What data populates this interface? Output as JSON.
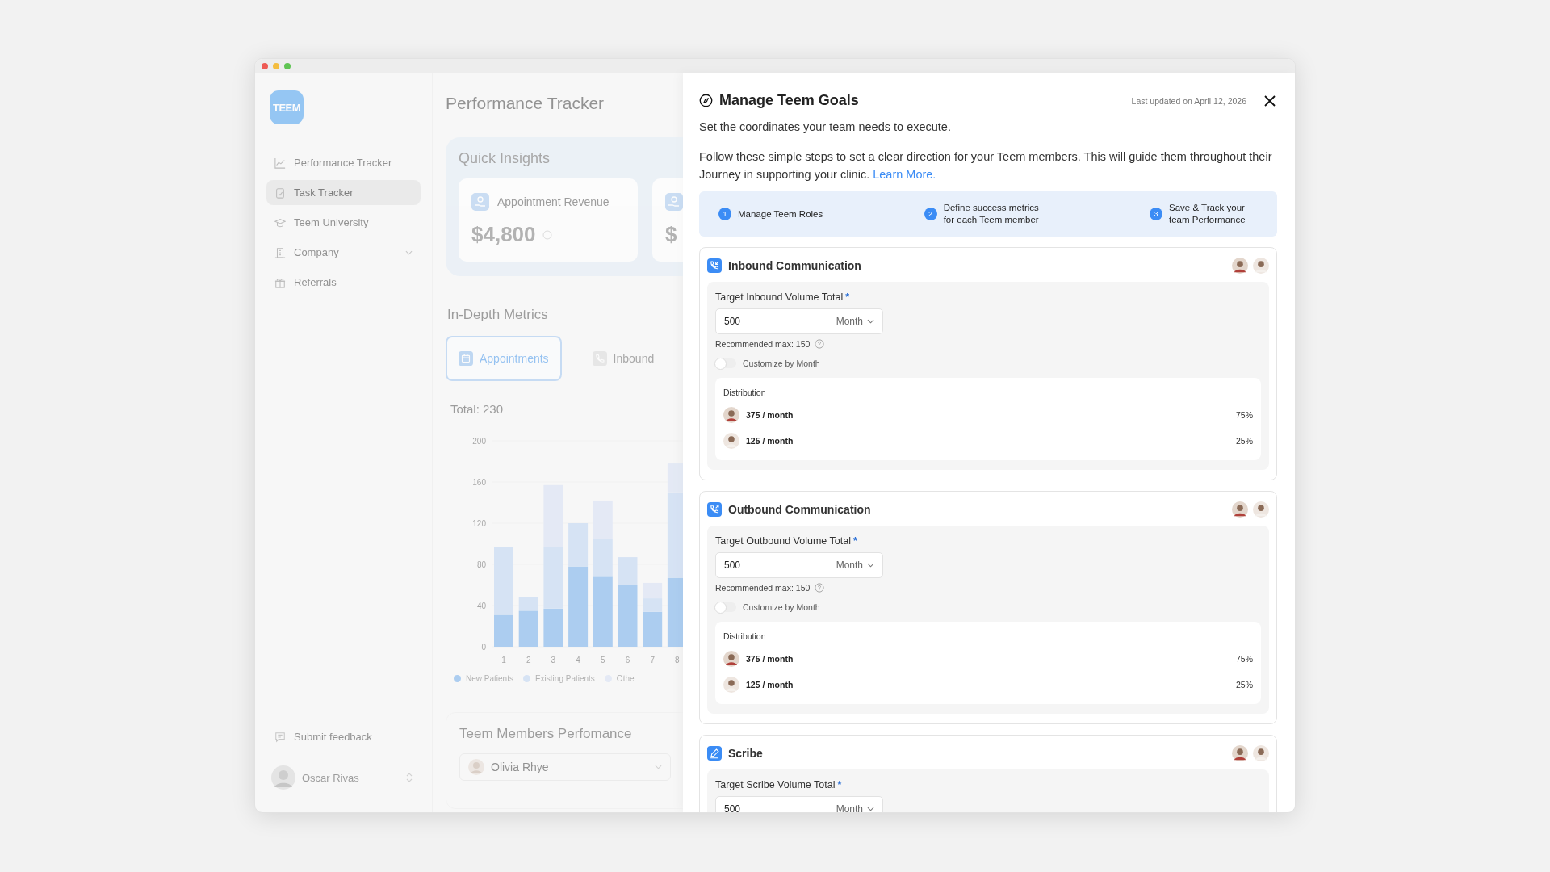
{
  "sidebar": {
    "logo": "TEEM",
    "items": [
      {
        "label": "Performance Tracker",
        "selected": false,
        "expandable": false
      },
      {
        "label": "Task Tracker",
        "selected": true,
        "expandable": false
      },
      {
        "label": "Teem University",
        "selected": false,
        "expandable": false
      },
      {
        "label": "Company",
        "selected": false,
        "expandable": true
      },
      {
        "label": "Referrals",
        "selected": false,
        "expandable": false
      }
    ],
    "feedback": "Submit feedback",
    "user": {
      "name": "Oscar Rivas"
    }
  },
  "main": {
    "title": "Performance Tracker",
    "insights": {
      "title": "Quick Insights",
      "cards": [
        {
          "label": "Appointment Revenue",
          "value": "$4,800"
        },
        {
          "value": "$"
        }
      ]
    },
    "metrics": {
      "title": "In-Depth Metrics",
      "tabs": [
        {
          "label": "Appointments",
          "selected": true
        },
        {
          "label": "Inbound",
          "selected": false
        }
      ],
      "total": "Total: 230",
      "chart_data": {
        "type": "bar",
        "stacked": true,
        "categories": [
          "1",
          "2",
          "3",
          "4",
          "5",
          "6",
          "7",
          "8"
        ],
        "ylim": [
          0,
          200
        ],
        "yticks": [
          0,
          40,
          80,
          120,
          160,
          200
        ],
        "series": [
          {
            "name": "New Patients",
            "color": "#7fb4ec",
            "values": [
              31,
              35,
              37,
              78,
              68,
              60,
              34,
              67
            ]
          },
          {
            "name": "Existing Patients",
            "color": "#c3d7f3",
            "values": [
              66,
              13,
              60,
              42,
              37,
              27,
              13,
              83
            ]
          },
          {
            "name": "Othe",
            "color": "#d9e2f4",
            "values": [
              0,
              0,
              60,
              0,
              37,
              0,
              15,
              28
            ]
          }
        ]
      }
    },
    "members": {
      "title": "Teem Members Perfomance",
      "select": {
        "value": "Olivia Rhye"
      }
    }
  },
  "panel": {
    "title": "Manage Teem Goals",
    "updated": "Last updated on April 12, 2026",
    "subtitle": "Set the coordinates your team needs to execute.",
    "intro": "Follow these simple steps to set a clear direction for your Teem members. This will guide them throughout their Journey in supporting your clinic.",
    "link": "Learn More.",
    "steps": [
      {
        "number": "1",
        "label": "Manage Teem Roles"
      },
      {
        "number": "2",
        "label": "Define success metrics for each Teem member"
      },
      {
        "number": "3",
        "label": "Save & Track your team Performance"
      }
    ],
    "sections": [
      {
        "kind": "inbound",
        "title": "Inbound Communication",
        "field_label": "Target Inbound Volume Total",
        "required_mark": "*",
        "value": "500",
        "period": "Month",
        "recommended": "Recommended max: 150",
        "toggle": {
          "label": "Customize by Month",
          "on": false
        },
        "distribution": {
          "title": "Distribution",
          "rows": [
            {
              "amount": "375 / month",
              "share": "75%"
            },
            {
              "amount": "125 / month",
              "share": "25%"
            }
          ]
        }
      },
      {
        "kind": "outbound",
        "title": "Outbound Communication",
        "field_label": "Target Outbound Volume Total",
        "required_mark": "*",
        "value": "500",
        "period": "Month",
        "recommended": "Recommended max: 150",
        "toggle": {
          "label": "Customize by Month",
          "on": false
        },
        "distribution": {
          "title": "Distribution",
          "rows": [
            {
              "amount": "375 / month",
              "share": "75%"
            },
            {
              "amount": "125 / month",
              "share": "25%"
            }
          ]
        }
      },
      {
        "kind": "scribe",
        "title": "Scribe",
        "field_label": "Target Scribe Volume Total",
        "required_mark": "*",
        "value": "500",
        "period": "Month"
      }
    ]
  }
}
